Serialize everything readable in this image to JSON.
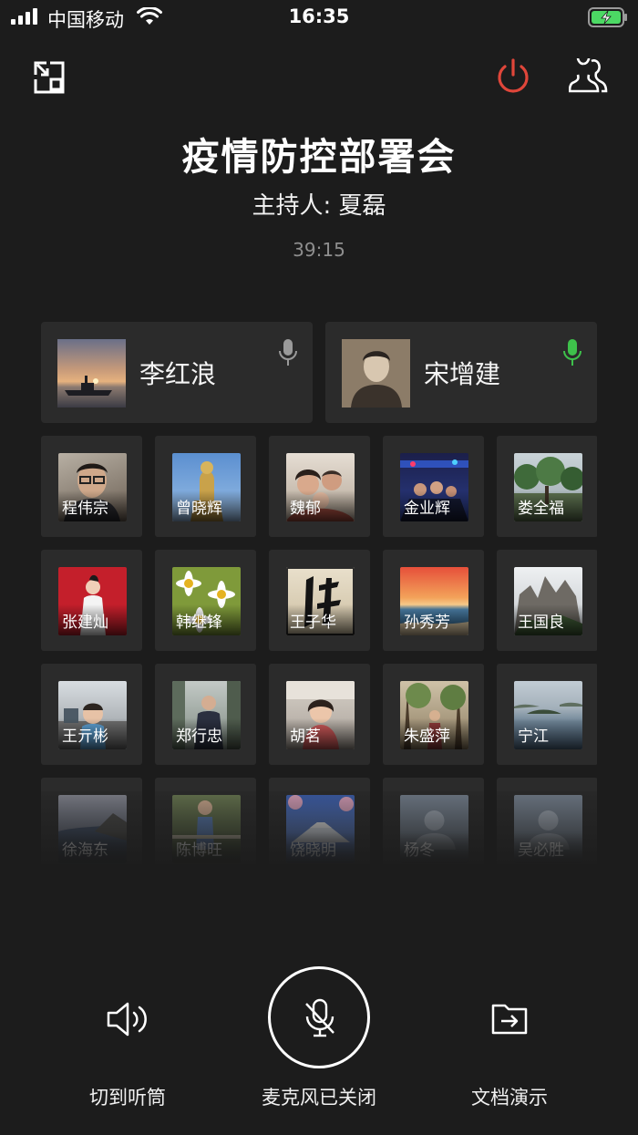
{
  "status_bar": {
    "carrier": "中国移动",
    "time": "16:35",
    "battery_color": "#4cd964"
  },
  "toolbar": {
    "minimize_icon": "picture-in-picture-icon",
    "end_meeting_icon": "power-icon",
    "end_meeting_color": "#e0463a",
    "members_icon": "members-icon"
  },
  "meeting": {
    "title": "疫情防控部署会",
    "host": "主持人: 夏磊",
    "elapsed": "39:15"
  },
  "speakers": [
    {
      "name": "李红浪",
      "mic_active": false
    },
    {
      "name": "宋增建",
      "mic_active": true
    }
  ],
  "mic_active_color": "#3ec14b",
  "participants": [
    {
      "name": "程伟宗"
    },
    {
      "name": "曾晓辉"
    },
    {
      "name": "魏郁"
    },
    {
      "name": "金业辉"
    },
    {
      "name": "娄全福"
    },
    {
      "name": "张建灿"
    },
    {
      "name": "韩继锋"
    },
    {
      "name": "王子华"
    },
    {
      "name": "孙秀芳"
    },
    {
      "name": "王国良"
    },
    {
      "name": "王亓彬"
    },
    {
      "name": "郑行忠"
    },
    {
      "name": "胡茗"
    },
    {
      "name": "朱盛萍"
    },
    {
      "name": "宁江"
    },
    {
      "name": "徐海东"
    },
    {
      "name": "陈博旺"
    },
    {
      "name": "饶晓明"
    },
    {
      "name": "杨冬"
    },
    {
      "name": "吴必胜"
    }
  ],
  "controls": {
    "earpiece_label": "切到听筒",
    "mic_label": "麦克风已关闭",
    "share_doc_label": "文档演示"
  }
}
